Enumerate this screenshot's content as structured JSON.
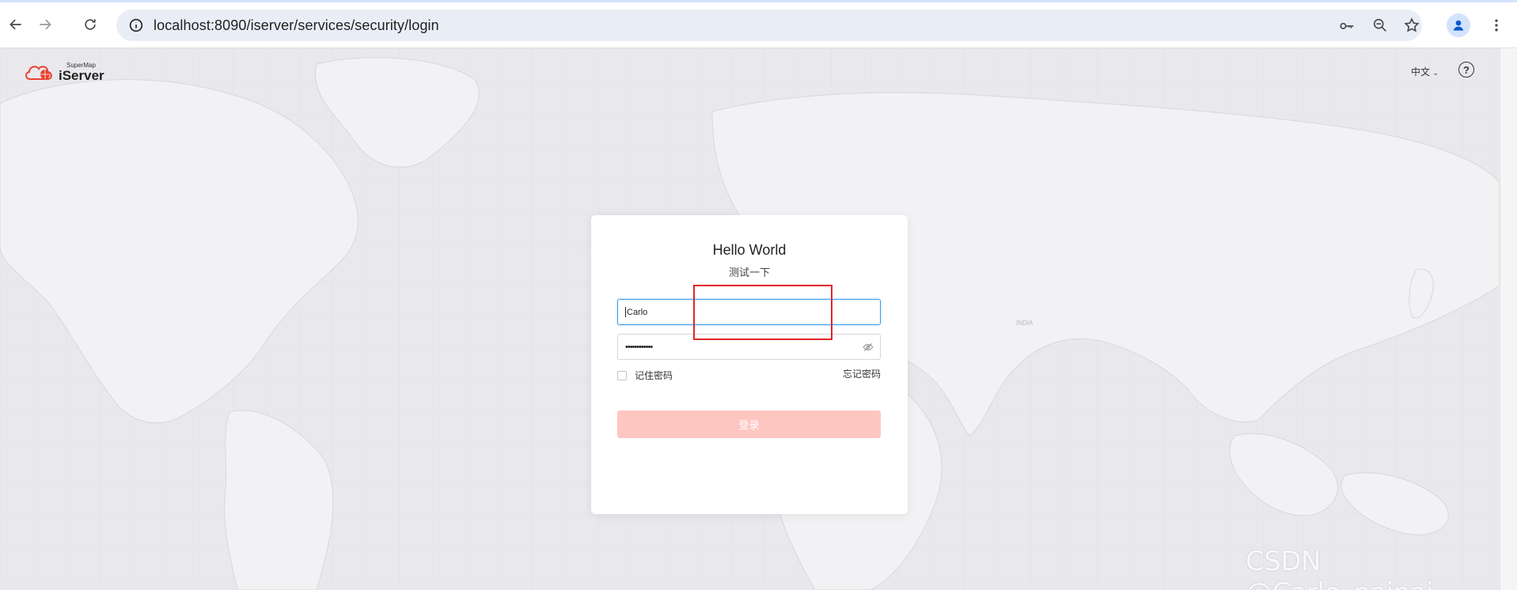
{
  "browser": {
    "url": "localhost:8090/iserver/services/security/login",
    "back_icon": "arrow-left-icon",
    "forward_icon": "arrow-right-icon",
    "reload_icon": "reload-icon",
    "info_icon": "info-icon",
    "password_icon": "key-icon",
    "zoom_icon": "zoom-out-icon",
    "bookmark_icon": "star-icon",
    "profile_icon": "user-avatar-icon",
    "menu_icon": "kebab-menu-icon"
  },
  "header": {
    "logo_small": "SuperMap",
    "logo_big": "iServer",
    "language": "中文",
    "help_icon": "question-circle-icon"
  },
  "login": {
    "title": "Hello World",
    "subtitle": "测试一下",
    "username_value": "Carlo",
    "password_value": "••••••••••••",
    "remember_label": "记住密码",
    "forgot_label": "忘记密码",
    "submit_label": "登录",
    "accent_color": "#3a9be6",
    "button_color": "#fec6c1",
    "highlight_color": "#e0262b"
  },
  "map": {
    "label": "INDIA"
  },
  "watermark": "CSDN @Carlo_paipai"
}
